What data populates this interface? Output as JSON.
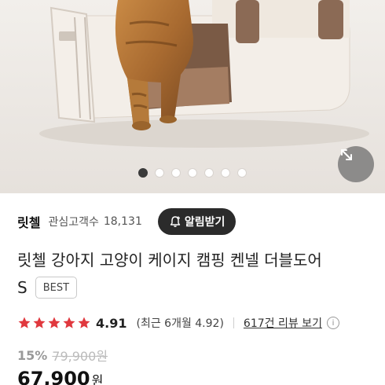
{
  "product_image": {
    "icon": "cat-in-pet-carrier-photo"
  },
  "carousel": {
    "total": 7,
    "active_index": 0,
    "expand_icon": "expand-arrows-icon"
  },
  "seller": {
    "name": "릿첼",
    "watchers_label": "관심고객수",
    "watchers_count": "18,131",
    "notify_label": "알림받기",
    "notify_icon": "bell-plus-icon"
  },
  "product": {
    "title": "릿첼 강아지 고양이 케이지 캠핑 켄넬 더블도어",
    "size": "S",
    "badge": "BEST"
  },
  "rating": {
    "stars": 5,
    "value": "4.91",
    "recent": "(최근 6개월 4.92)",
    "review_link": "617건 리뷰 보기",
    "info_icon": "info-icon"
  },
  "price": {
    "discount": "15%",
    "original": "79,900원",
    "sale": "67,900",
    "unit": "원"
  },
  "colors": {
    "star": "#e0383e",
    "notify_bg": "#2b2b2b",
    "carrier_brown": "#8b6a55",
    "carrier_cream": "#f1ebe3"
  }
}
